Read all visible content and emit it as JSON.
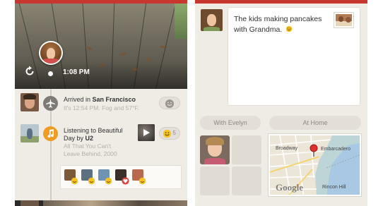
{
  "colors": {
    "accent_red": "#c7372f",
    "timeline_orange": "#f09c22",
    "background": "#efece6"
  },
  "left_screen": {
    "cover": {
      "time": "1:08 PM",
      "refresh_icon": "refresh-icon"
    },
    "moments": [
      {
        "icon": "airplane-icon",
        "title_prefix": "Arrived in ",
        "title_bold": "San Francisco",
        "subtitle": "It's 12:54 PM. Fog and 57°F.",
        "emotion": "smiley-icon"
      },
      {
        "icon": "music-note-icon",
        "title_line1": "Listening to Beautiful",
        "title_line2_prefix": "Day by ",
        "title_line2_bold": "U2",
        "subtitle_line1": "All That You Can't",
        "subtitle_line2": "Leave Behind, 2000",
        "emotion": "smiley-icon",
        "emotion_count": "5"
      }
    ]
  },
  "right_screen": {
    "post": {
      "text": "The kids making pancakes with Grandma."
    },
    "with_label": "With Evelyn",
    "place_label": "At Home",
    "map": {
      "labels": {
        "broadway": "Broadway",
        "embarcadero": "Embarcadero",
        "rincon_hill": "Rincon Hill",
        "google": "Google"
      }
    }
  }
}
